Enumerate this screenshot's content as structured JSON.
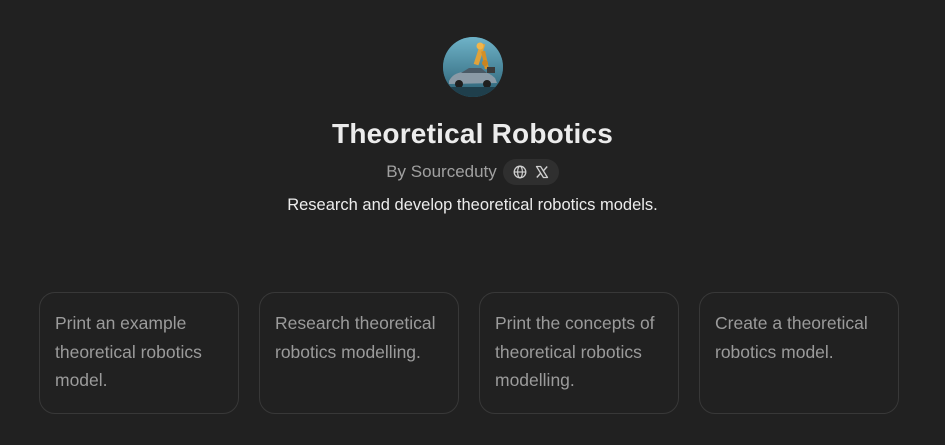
{
  "gpt": {
    "title": "Theoretical Robotics",
    "byline": "By Sourceduty",
    "description": "Research and develop theoretical robotics models."
  },
  "social_links": [
    {
      "icon": "globe-icon"
    },
    {
      "icon": "x-logo-icon"
    }
  ],
  "prompts": [
    {
      "text": "Print an example theoretical robotics model."
    },
    {
      "text": "Research theoretical robotics modelling."
    },
    {
      "text": "Print the concepts of theoretical robotics modelling."
    },
    {
      "text": "Create a theoretical robotics model."
    }
  ],
  "colors": {
    "background": "#212121",
    "card_border": "#383838",
    "pill_background": "#2f2f2f",
    "muted_text": "#9b9b9b",
    "primary_text": "#ececec"
  }
}
